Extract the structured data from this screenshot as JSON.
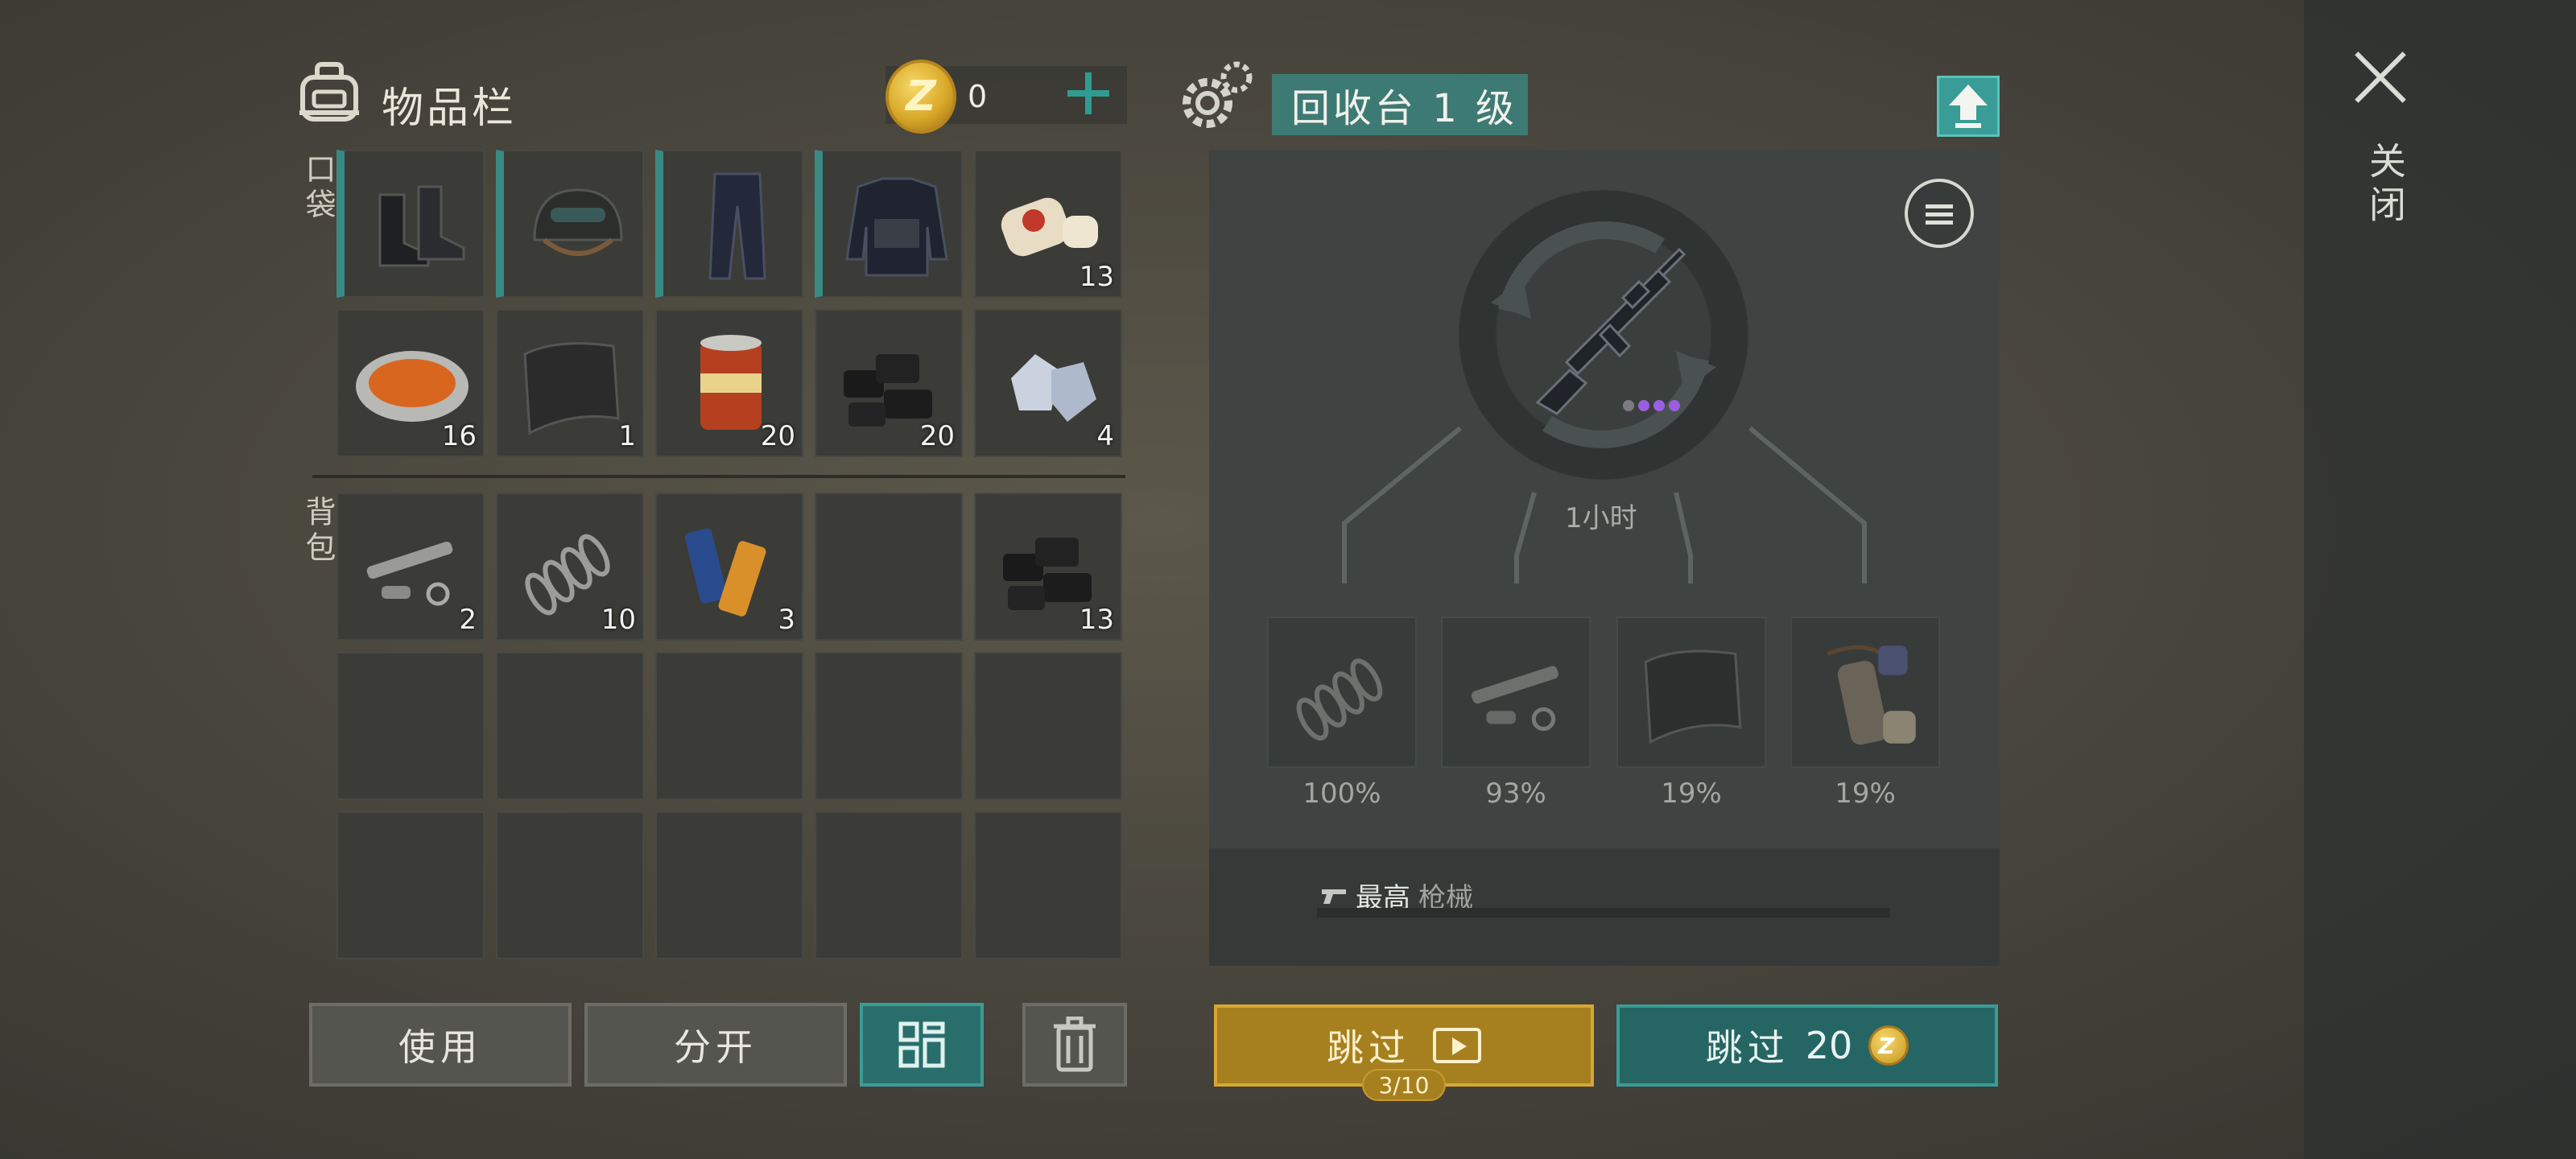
{
  "inventory": {
    "title": "物品栏",
    "coins": "0",
    "pockets_label": "口袋",
    "backpack_label": "背包",
    "pockets": [
      {
        "name": "boots",
        "count": ""
      },
      {
        "name": "helmet",
        "count": ""
      },
      {
        "name": "pants",
        "count": ""
      },
      {
        "name": "armor-vest",
        "count": ""
      },
      {
        "name": "bandage",
        "count": "13"
      },
      {
        "name": "stew-bowl",
        "count": "16"
      },
      {
        "name": "carbon-fabric",
        "count": "1"
      },
      {
        "name": "canned-food",
        "count": "20"
      },
      {
        "name": "coal",
        "count": "20"
      },
      {
        "name": "crystals",
        "count": "4"
      }
    ],
    "backpack": [
      {
        "name": "gun-parts",
        "count": "2"
      },
      {
        "name": "spring",
        "count": "10"
      },
      {
        "name": "batteries",
        "count": "3"
      },
      {
        "name": "empty",
        "count": ""
      },
      {
        "name": "coal",
        "count": "13"
      }
    ],
    "buttons": {
      "use": "使用",
      "split": "分开"
    }
  },
  "recycler": {
    "title": "回收台 1 级",
    "timer": "1小时",
    "outputs": [
      {
        "name": "spring",
        "percent": "100%"
      },
      {
        "name": "gun-parts",
        "percent": "93%"
      },
      {
        "name": "carbon-fabric",
        "percent": "19%"
      },
      {
        "name": "gun-barrel-kit",
        "percent": "19%"
      }
    ],
    "stat": {
      "prefix": "最高",
      "category": "枪械"
    },
    "skip_ad": {
      "label": "跳过",
      "count": "3/10"
    },
    "skip_coin": {
      "label": "跳过",
      "cost": "20"
    }
  },
  "close": {
    "label": "关闭"
  },
  "colors": {
    "accent": "#3a9c96",
    "gold": "#a6801f",
    "dot_purple": "#9a5ee0"
  }
}
